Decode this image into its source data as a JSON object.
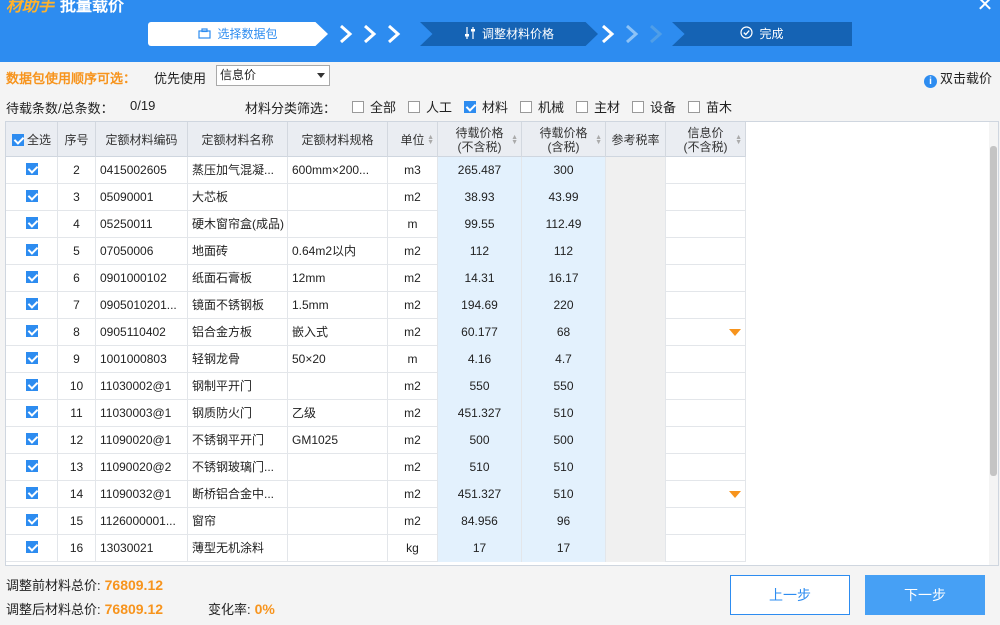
{
  "app": {
    "brand": "材助手",
    "title": "批量载价"
  },
  "steps": [
    {
      "label": "选择数据包",
      "icon": "package-icon"
    },
    {
      "label": "调整材料价格",
      "icon": "sliders-icon"
    },
    {
      "label": "完成",
      "icon": "check-circle-icon"
    }
  ],
  "order": {
    "label": "数据包使用顺序可选：",
    "prefer_label": "优先使用",
    "selected": "信息价",
    "tip": "双击载价"
  },
  "counts": {
    "label": "待载条数/总条数：",
    "value": "0/19"
  },
  "filter": {
    "label": "材料分类筛选：",
    "options": [
      {
        "label": "全部",
        "checked": false
      },
      {
        "label": "人工",
        "checked": false
      },
      {
        "label": "材料",
        "checked": true
      },
      {
        "label": "机械",
        "checked": false
      },
      {
        "label": "主材",
        "checked": false
      },
      {
        "label": "设备",
        "checked": false
      },
      {
        "label": "苗木",
        "checked": false
      }
    ]
  },
  "table": {
    "headers": {
      "select_all": "全选",
      "seq": "序号",
      "code": "定额材料编码",
      "name": "定额材料名称",
      "spec": "定额材料规格",
      "unit": "单位",
      "price_ex": "待载价格\n(不含税)",
      "price_in": "待载价格\n(含税)",
      "tax": "参考税率",
      "info": "信息价\n(不含税)"
    },
    "rows": [
      {
        "seq": "2",
        "code": "0415002605",
        "name": "蒸压加气混凝...",
        "spec": "600mm×200...",
        "unit": "m3",
        "price_ex": "265.487",
        "price_in": "300",
        "dropdown": false
      },
      {
        "seq": "3",
        "code": "05090001",
        "name": "大芯板",
        "spec": "",
        "unit": "m2",
        "price_ex": "38.93",
        "price_in": "43.99",
        "dropdown": false
      },
      {
        "seq": "4",
        "code": "05250011",
        "name": "硬木窗帘盒(成品)",
        "spec": "",
        "unit": "m",
        "price_ex": "99.55",
        "price_in": "112.49",
        "dropdown": false
      },
      {
        "seq": "5",
        "code": "07050006",
        "name": "地面砖",
        "spec": "0.64m2以内",
        "unit": "m2",
        "price_ex": "112",
        "price_in": "112",
        "dropdown": false
      },
      {
        "seq": "6",
        "code": "0901000102",
        "name": "纸面石膏板",
        "spec": "12mm",
        "unit": "m2",
        "price_ex": "14.31",
        "price_in": "16.17",
        "dropdown": false
      },
      {
        "seq": "7",
        "code": "0905010201...",
        "name": "镜面不锈钢板",
        "spec": "1.5mm",
        "unit": "m2",
        "price_ex": "194.69",
        "price_in": "220",
        "dropdown": false
      },
      {
        "seq": "8",
        "code": "0905110402",
        "name": "铝合金方板",
        "spec": "嵌入式",
        "unit": "m2",
        "price_ex": "60.177",
        "price_in": "68",
        "dropdown": true
      },
      {
        "seq": "9",
        "code": "1001000803",
        "name": "轻钢龙骨",
        "spec": "50×20",
        "unit": "m",
        "price_ex": "4.16",
        "price_in": "4.7",
        "dropdown": false
      },
      {
        "seq": "10",
        "code": "11030002@1",
        "name": "钢制平开门",
        "spec": "",
        "unit": "m2",
        "price_ex": "550",
        "price_in": "550",
        "dropdown": false
      },
      {
        "seq": "11",
        "code": "11030003@1",
        "name": "钢质防火门",
        "spec": "乙级",
        "unit": "m2",
        "price_ex": "451.327",
        "price_in": "510",
        "dropdown": false
      },
      {
        "seq": "12",
        "code": "11090020@1",
        "name": "不锈钢平开门",
        "spec": "GM1025",
        "unit": "m2",
        "price_ex": "500",
        "price_in": "500",
        "dropdown": false
      },
      {
        "seq": "13",
        "code": "11090020@2",
        "name": "不锈钢玻璃门...",
        "spec": "",
        "unit": "m2",
        "price_ex": "510",
        "price_in": "510",
        "dropdown": false
      },
      {
        "seq": "14",
        "code": "11090032@1",
        "name": "断桥铝合金中...",
        "spec": "",
        "unit": "m2",
        "price_ex": "451.327",
        "price_in": "510",
        "dropdown": true
      },
      {
        "seq": "15",
        "code": "1126000001...",
        "name": "窗帘",
        "spec": "",
        "unit": "m2",
        "price_ex": "84.956",
        "price_in": "96",
        "dropdown": false
      },
      {
        "seq": "16",
        "code": "13030021",
        "name": "薄型无机涂料",
        "spec": "",
        "unit": "kg",
        "price_ex": "17",
        "price_in": "17",
        "dropdown": false
      }
    ]
  },
  "footer": {
    "before_label": "调整前材料总价:",
    "before_value": "76809.12",
    "after_label": "调整后材料总价:",
    "after_value": "76809.12",
    "change_label": "变化率:",
    "change_value": "0%",
    "prev_label": "上一步",
    "next_label": "下一步"
  },
  "colors": {
    "primary": "#2d8cf0",
    "accent": "#f7941d",
    "dark_step": "#1563b4"
  }
}
